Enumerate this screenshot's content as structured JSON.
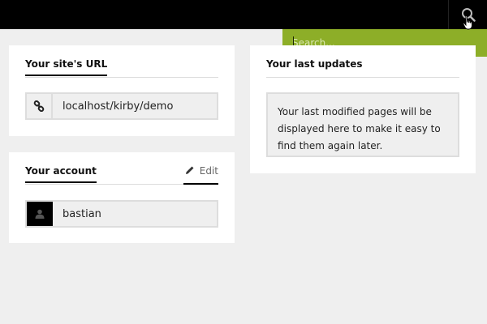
{
  "topbar": {
    "search_icon": "search-icon"
  },
  "search": {
    "placeholder": "Search..."
  },
  "site_url_card": {
    "title": "Your site's URL",
    "link_icon": "link-icon",
    "url": "localhost/kirby/demo"
  },
  "account_card": {
    "title": "Your account",
    "edit_label": "Edit",
    "edit_icon": "pencil-icon",
    "username": "bastian",
    "avatar_icon": "user-icon"
  },
  "updates_card": {
    "title": "Your last updates",
    "message": "Your last modified pages will be displayed here to make it easy to find them again later."
  },
  "colors": {
    "topbar": "#000000",
    "search_panel": "#8dae28",
    "background": "#efefef"
  }
}
